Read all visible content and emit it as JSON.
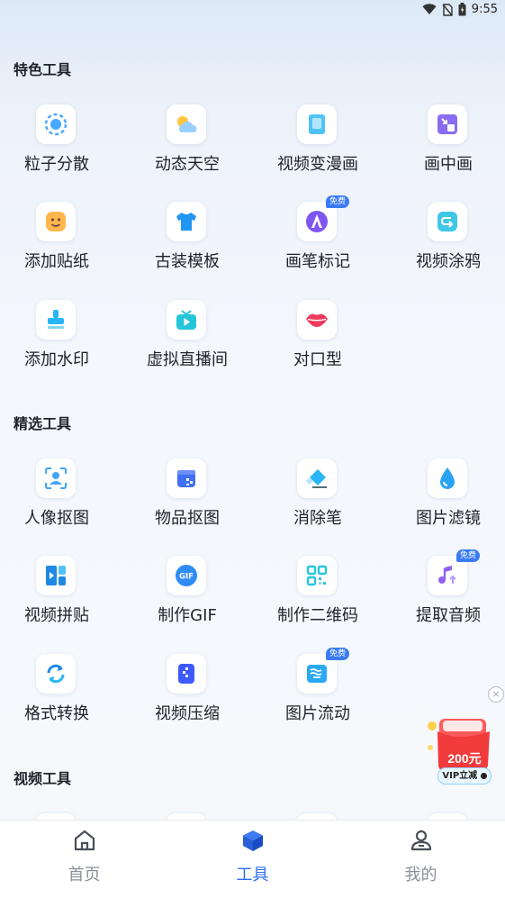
{
  "status": {
    "time": "9:55"
  },
  "sections": {
    "featured": {
      "title": "特色工具"
    },
    "selected": {
      "title": "精选工具"
    },
    "video": {
      "title": "视频工具"
    }
  },
  "featured_tools": [
    {
      "label": "粒子分散",
      "icon": "particle-icon"
    },
    {
      "label": "动态天空",
      "icon": "weather-icon"
    },
    {
      "label": "视频变漫画",
      "icon": "comic-icon"
    },
    {
      "label": "画中画",
      "icon": "pip-icon"
    },
    {
      "label": "添加贴纸",
      "icon": "sticker-icon"
    },
    {
      "label": "古装模板",
      "icon": "costume-icon"
    },
    {
      "label": "画笔标记",
      "icon": "pen-icon",
      "badge": "免费"
    },
    {
      "label": "视频涂鸦",
      "icon": "doodle-icon"
    },
    {
      "label": "添加水印",
      "icon": "stamp-icon"
    },
    {
      "label": "虚拟直播间",
      "icon": "tv-icon"
    },
    {
      "label": "对口型",
      "icon": "lips-icon"
    }
  ],
  "selected_tools": [
    {
      "label": "人像抠图",
      "icon": "portrait-icon"
    },
    {
      "label": "物品抠图",
      "icon": "object-cutout-icon"
    },
    {
      "label": "消除笔",
      "icon": "eraser-icon"
    },
    {
      "label": "图片滤镜",
      "icon": "filter-drop-icon"
    },
    {
      "label": "视频拼贴",
      "icon": "collage-icon"
    },
    {
      "label": "制作GIF",
      "icon": "gif-icon"
    },
    {
      "label": "制作二维码",
      "icon": "qrcode-icon"
    },
    {
      "label": "提取音频",
      "icon": "music-icon",
      "badge": "免费"
    },
    {
      "label": "格式转换",
      "icon": "convert-icon"
    },
    {
      "label": "视频压缩",
      "icon": "compress-icon"
    },
    {
      "label": "图片流动",
      "icon": "flow-icon",
      "badge": "免费"
    }
  ],
  "promo": {
    "amount": "200元",
    "cta": "VIP立减"
  },
  "tabs": [
    {
      "label": "首页",
      "icon": "home-icon",
      "active": false
    },
    {
      "label": "工具",
      "icon": "cube-icon",
      "active": true
    },
    {
      "label": "我的",
      "icon": "profile-icon",
      "active": false
    }
  ],
  "colors": {
    "accent": "#2f6ff2",
    "badge": "#3a7bf5",
    "inactive_tab": "#8a8f99"
  }
}
